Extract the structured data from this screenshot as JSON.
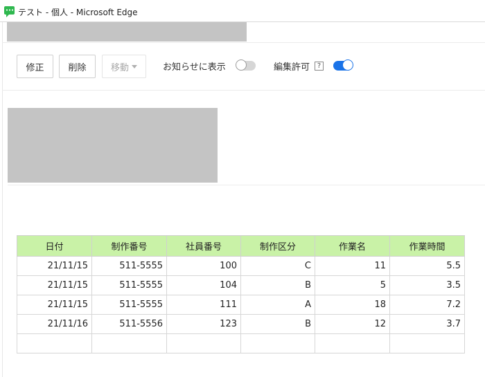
{
  "window": {
    "title": "テスト - 個人 - Microsoft Edge"
  },
  "toolbar": {
    "edit_label": "修正",
    "delete_label": "削除",
    "move_label": "移動",
    "notice_label": "お知らせに表示",
    "notice_enabled": false,
    "edit_permission_label": "編集許可",
    "edit_permission_help": "?",
    "edit_permission_enabled": true
  },
  "table": {
    "headers": [
      "日付",
      "制作番号",
      "社員番号",
      "制作区分",
      "作業名",
      "作業時間"
    ],
    "header_color": "#c9f2a7",
    "rows": [
      [
        "21/11/15",
        "511-5555",
        "100",
        "C",
        "11",
        "5.5"
      ],
      [
        "21/11/15",
        "511-5555",
        "104",
        "B",
        "5",
        "3.5"
      ],
      [
        "21/11/15",
        "511-5555",
        "111",
        "A",
        "18",
        "7.2"
      ],
      [
        "21/11/16",
        "511-5556",
        "123",
        "B",
        "12",
        "3.7"
      ],
      [
        "",
        "",
        "",
        "",
        "",
        ""
      ]
    ]
  }
}
